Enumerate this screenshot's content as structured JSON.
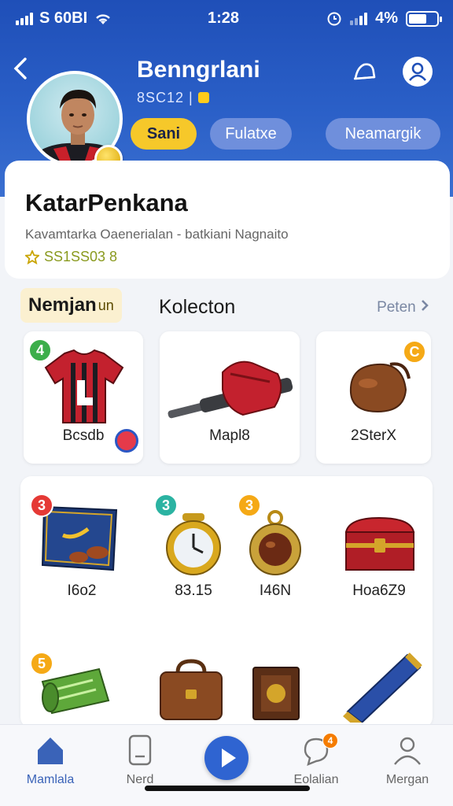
{
  "status_bar": {
    "carrier": "S 60BI",
    "time": "1:28",
    "battery": "4%"
  },
  "profile": {
    "name": "Benngrlani",
    "id_text": "8SC12 |",
    "buttons": {
      "primary": "Sani",
      "secondary": "Fulatxe",
      "tertiary": "Neamargik"
    }
  },
  "info_card": {
    "title": "KatarPenkana",
    "subtitle": "Kavamtarka Oaenerialan - batkiani Nagnaito",
    "points": "SS1SS03  8"
  },
  "tabs": {
    "active": "Nemjan",
    "active_suffix": "un",
    "second": "Kolecton",
    "see_all": "Peten"
  },
  "featured_items": [
    {
      "label": "Bcsdb",
      "badge": "4",
      "badge_color": "#3cae4a",
      "icon": "jersey-icon"
    },
    {
      "label": "Mapl8",
      "icon": "bazooka-bag-icon"
    },
    {
      "label": "2SterX",
      "badge": "C",
      "badge_color": "#f5a916",
      "icon": "pouch-icon"
    }
  ],
  "collection_items": [
    {
      "label": "I6o2",
      "badge": "3",
      "badge_color": "#e53935",
      "icon": "book-icon"
    },
    {
      "label": "83.15",
      "badge": "3",
      "badge_color": "#2bb3a2",
      "icon": "clock-icon"
    },
    {
      "label": "I46N",
      "badge": "3",
      "badge_color": "#f5a916",
      "icon": "amulet-icon"
    },
    {
      "label": "Hoa6Z9",
      "icon": "chest-icon"
    },
    {
      "label": "",
      "badge": "5",
      "badge_color": "#f5a916",
      "icon": "map-icon"
    },
    {
      "label": "",
      "icon": "suitcase-icon"
    },
    {
      "label": "",
      "icon": "frame-icon"
    },
    {
      "label": "",
      "icon": "telescope-icon"
    }
  ],
  "nav": {
    "items": [
      "Mamlala",
      "Nerd",
      "",
      "Eolalian",
      "Mergan"
    ],
    "notification_dot": "4"
  },
  "colors": {
    "primary": "#2f64d1",
    "accent_yellow": "#f6c82a"
  }
}
